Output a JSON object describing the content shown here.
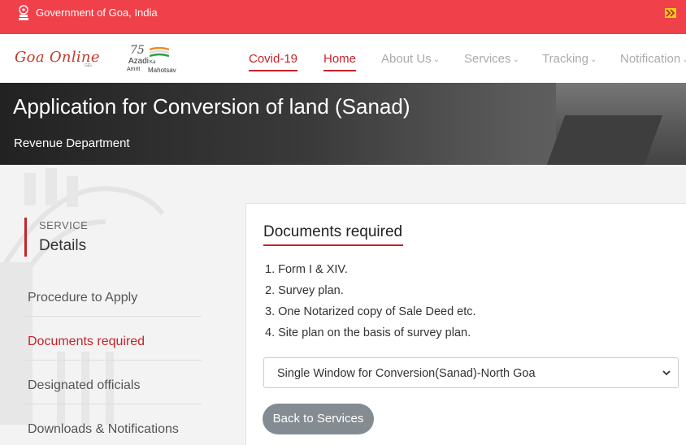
{
  "topbar": {
    "gov_text": "Government of Goa, India"
  },
  "logo": {
    "name": "Goa Online",
    "sub": "GEL"
  },
  "amrit": {
    "number": "75",
    "line1": "Azadi",
    "line2": "Ka",
    "line3": "Amrit",
    "line4": "Mahotsav"
  },
  "nav": {
    "covid": "Covid-19",
    "home": "Home",
    "about": "About Us",
    "services": "Services",
    "tracking": "Tracking",
    "notifications": "Notification"
  },
  "banner": {
    "title": "Application for Conversion of land (Sanad)",
    "department": "Revenue Department"
  },
  "sidebar": {
    "service_label": "SERVICE",
    "details_label": "Details",
    "items": [
      {
        "label": "Procedure to Apply"
      },
      {
        "label": "Documents required"
      },
      {
        "label": "Designated officials"
      },
      {
        "label": "Downloads & Notifications"
      }
    ]
  },
  "content": {
    "title": "Documents required",
    "documents": [
      "1. Form I & XIV.",
      "2. Survey plan.",
      "3. One Notarized copy of Sale Deed etc.",
      "4. Site plan on the basis of survey plan."
    ],
    "select_value": "Single Window for Conversion(Sanad)-North Goa",
    "back_button": "Back to Services"
  },
  "colors": {
    "accent": "#c4232b",
    "topbar": "#f0404a",
    "button": "#848c92"
  }
}
